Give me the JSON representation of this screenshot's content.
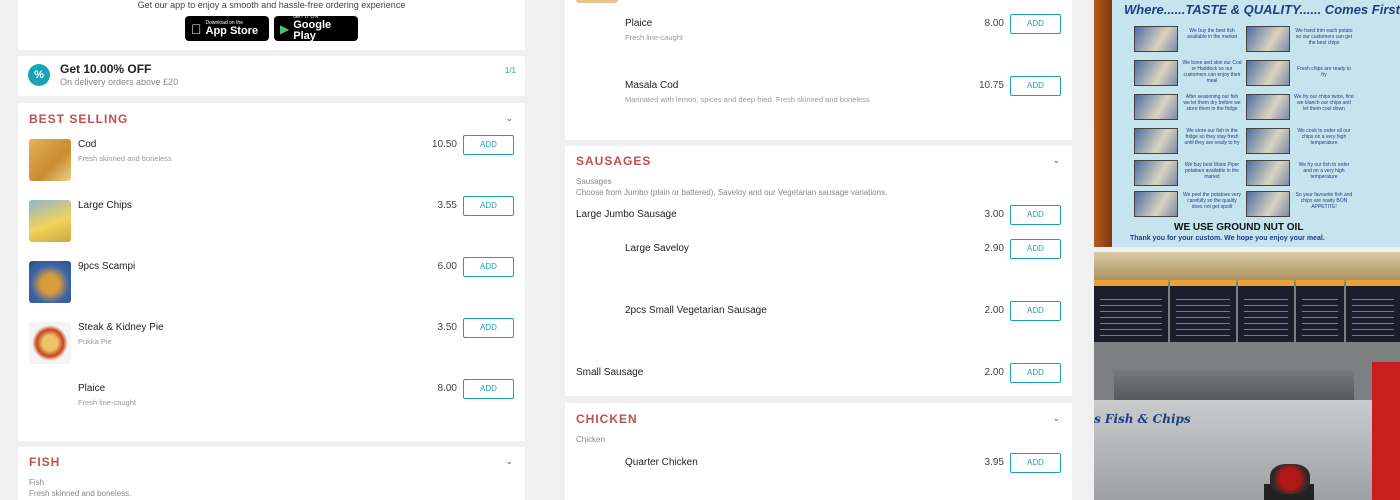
{
  "app_promo": {
    "text": "Get our app to enjoy a smooth and hassle-free ordering experience",
    "app_store_small": "Download on the",
    "app_store_big": "App Store",
    "google_small": "GET IT ON",
    "google_big": "Google Play"
  },
  "promo": {
    "icon": "%",
    "title": "Get 10.00% OFF",
    "subtitle": "On delivery orders above £20",
    "counter": "1/1"
  },
  "best_selling": {
    "title": "BEST SELLING",
    "chevron": "⌄",
    "items": [
      {
        "name": "Cod",
        "desc": "Fresh skinned and boneless",
        "price": "10.50",
        "add": "ADD"
      },
      {
        "name": "Large Chips",
        "desc": "",
        "price": "3.55",
        "add": "ADD"
      },
      {
        "name": "9pcs Scampi",
        "desc": "",
        "price": "6.00",
        "add": "ADD"
      },
      {
        "name": "Steak & Kidney Pie",
        "desc": "Pukka Pie",
        "price": "3.50",
        "add": "ADD"
      },
      {
        "name": "Plaice",
        "desc": "Fresh line-caught",
        "price": "8.00",
        "add": "ADD"
      }
    ]
  },
  "fish": {
    "title": "FISH",
    "chevron": "⌄",
    "label": "Fish",
    "desc": "Fresh skinned and boneless."
  },
  "fish_continued": {
    "items": [
      {
        "name": "Plaice",
        "desc": "Fresh line-caught",
        "price": "8.00",
        "add": "ADD"
      },
      {
        "name": "Masala Cod",
        "desc": "Marinated with lemon, spices and deep fried. Fresh skinned and boneless",
        "price": "10.75",
        "add": "ADD"
      }
    ]
  },
  "sausages": {
    "title": "SAUSAGES",
    "chevron": "⌄",
    "label": "Sausages",
    "desc": "Choose from Jumbo (plain or battered), Saveloy and our Vegetarian sausage variations.",
    "items": [
      {
        "name": "Large Jumbo Sausage",
        "price": "3.00",
        "add": "ADD"
      },
      {
        "name": "Large Saveloy",
        "price": "2.90",
        "add": "ADD"
      },
      {
        "name": "2pcs Small Vegetarian Sausage",
        "price": "2.00",
        "add": "ADD"
      },
      {
        "name": "Small Sausage",
        "price": "2.00",
        "add": "ADD"
      }
    ]
  },
  "chicken": {
    "title": "CHICKEN",
    "chevron": "⌄",
    "label": "Chicken",
    "items": [
      {
        "name": "Quarter Chicken",
        "price": "3.95",
        "add": "ADD"
      }
    ]
  },
  "poster": {
    "title": "Where......TASTE & QUALITY...... Comes First",
    "rows": [
      {
        "left": "We buy the best fish available in the market",
        "right": "We hand trim each potato so our customers can get the best chips"
      },
      {
        "left": "We bone and skin our Cod or Haddock so our customers can enjoy their meal",
        "right": "Fresh chips are ready to fry"
      },
      {
        "left": "After seasoning our fish we let them dry before we store them in the fridge",
        "right": "We fry our chips twice, first we blanch our chips and let them cool down"
      },
      {
        "left": "We store our fish in the fridge so they stay fresh until they are ready to fry",
        "right": "We cook to order all our chips on a very high temperature"
      },
      {
        "left": "We buy best Maris Piper potatoes available in the market",
        "right": "We fry our fish to order and on a very high temperature"
      },
      {
        "left": "We peel the potatoes very carefully so the quality does not get spoilt",
        "right": "So your favourite fish and chips are ready BON APPETITE!"
      }
    ],
    "footer": "WE USE GROUND NUT OIL",
    "thanks": "Thank you for your custom. We hope you enjoy your meal."
  },
  "shop_photo": {
    "sign": "s Fish & Chips"
  }
}
